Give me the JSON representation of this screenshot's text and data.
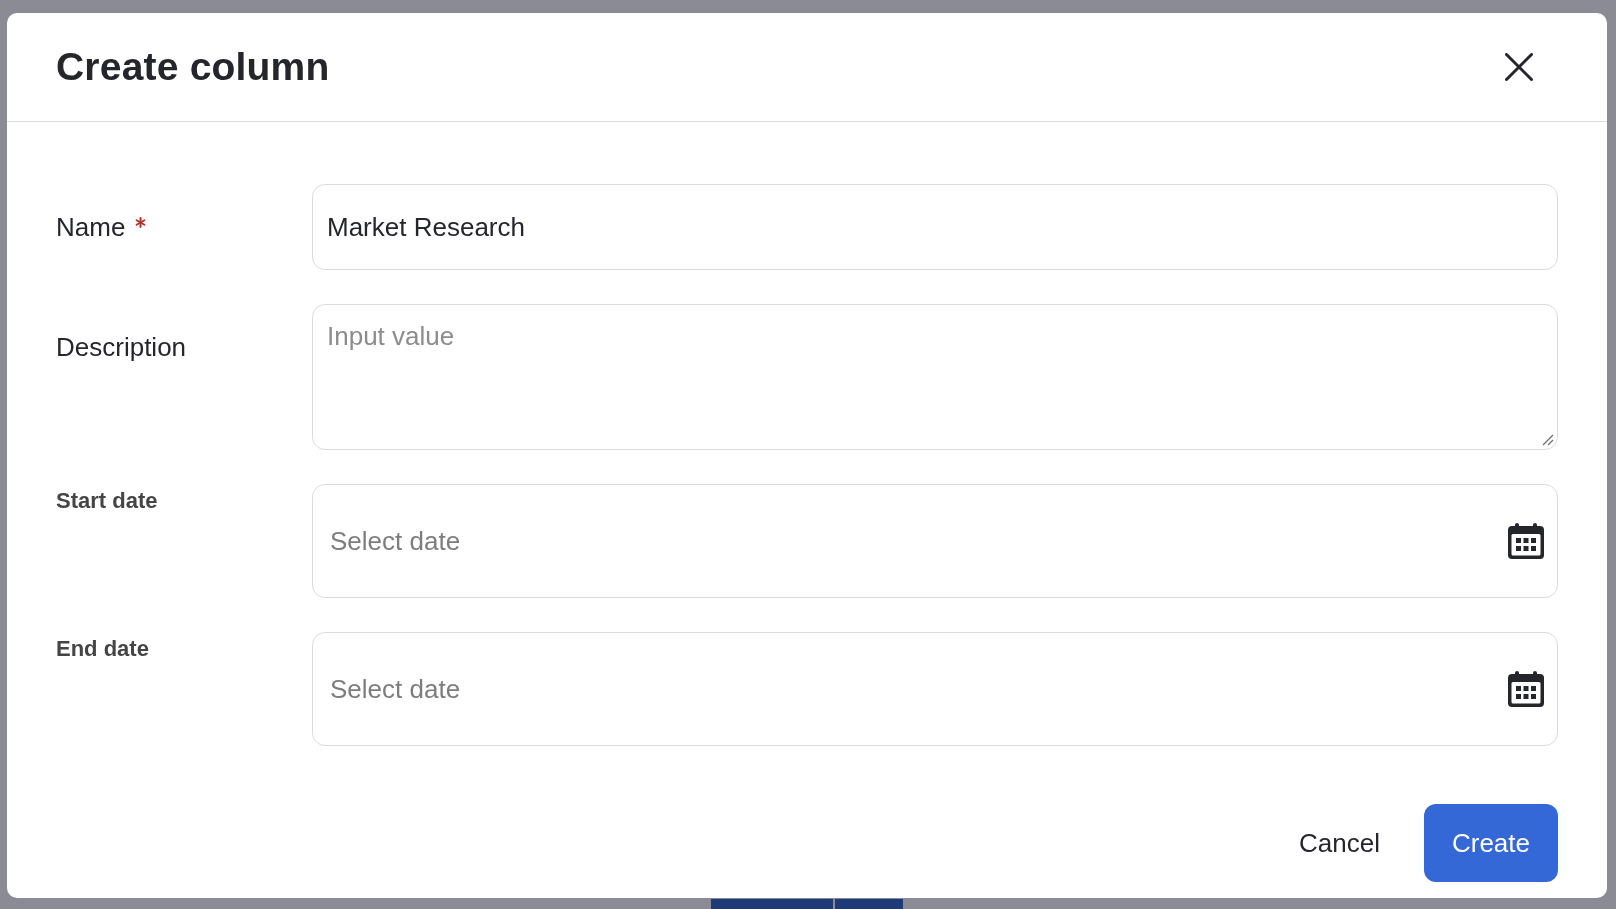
{
  "dialog": {
    "title": "Create column",
    "fields": [
      {
        "kind": "text",
        "label": "Name",
        "required": true,
        "value": "Market Research"
      },
      {
        "kind": "textarea",
        "label": "Description",
        "required": false,
        "placeholder": "Input value"
      },
      {
        "kind": "date",
        "label": "Start date",
        "required": false,
        "placeholder": "Select date"
      },
      {
        "kind": "date",
        "label": "End date",
        "required": false,
        "placeholder": "Select date"
      }
    ],
    "buttons": [
      {
        "kind": "secondary",
        "label": "Cancel"
      },
      {
        "kind": "primary",
        "label": "Create"
      }
    ]
  }
}
